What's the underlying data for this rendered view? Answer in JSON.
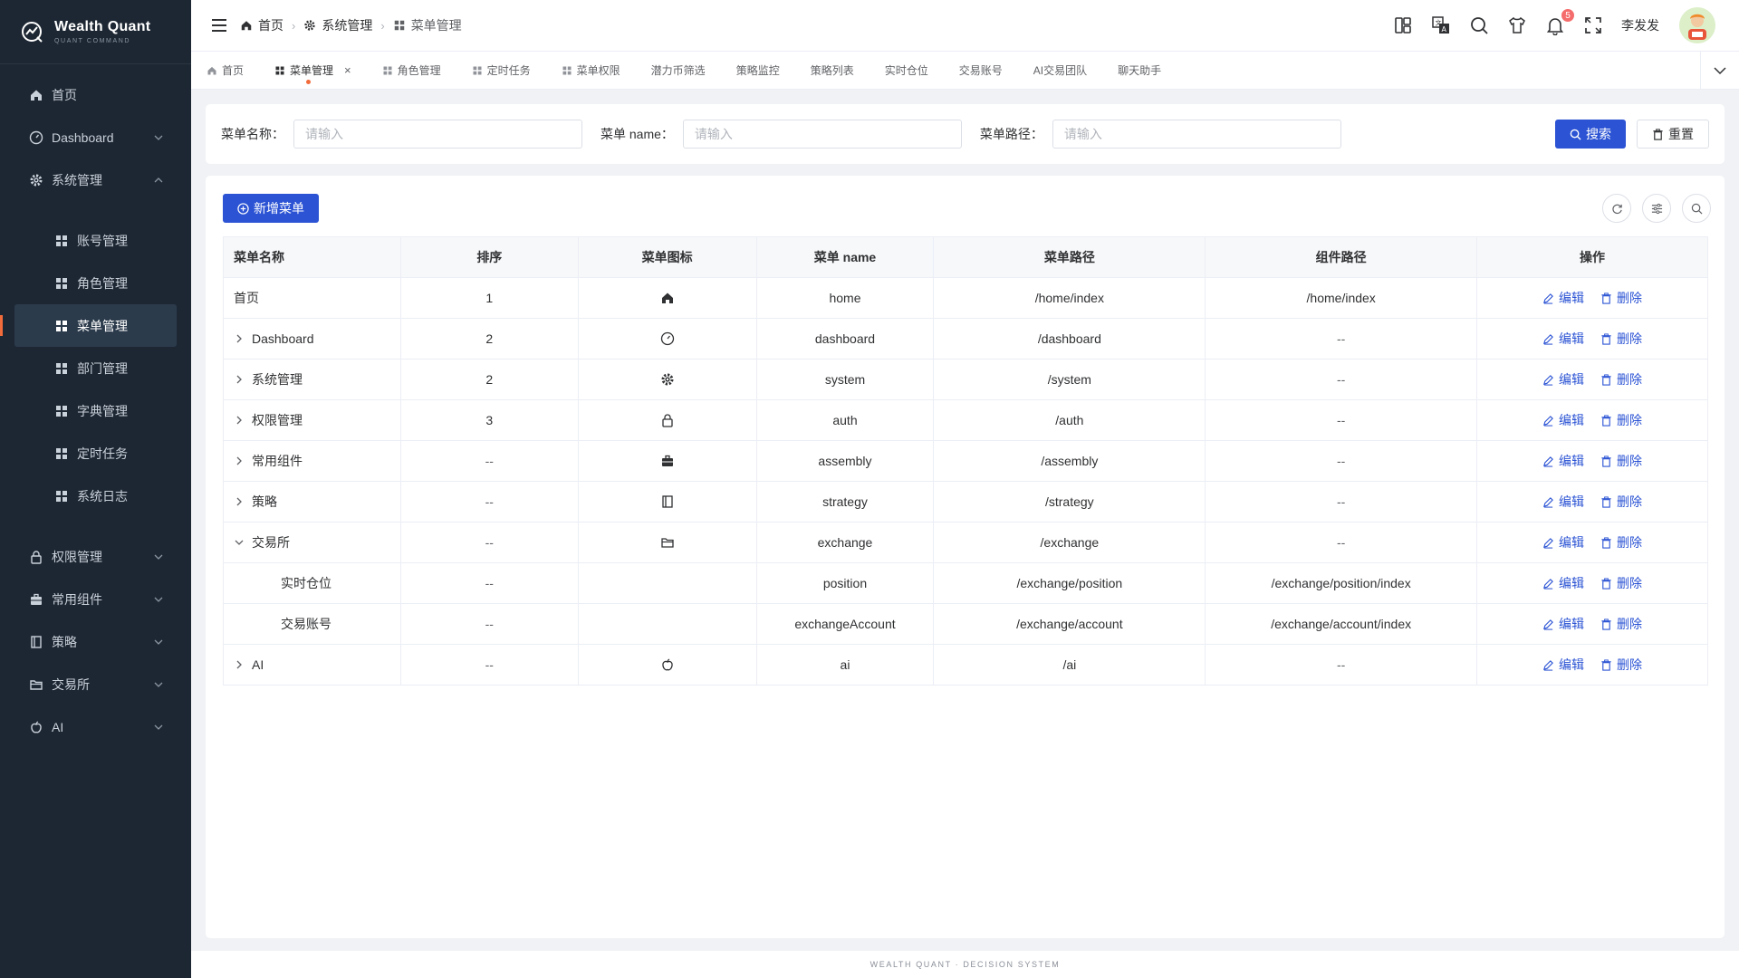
{
  "app": {
    "name": "Wealth Quant",
    "subtitle": "QUANT COMMAND",
    "footer": "WEALTH QUANT · DECISION SYSTEM"
  },
  "sidebar": {
    "items": [
      {
        "label": "首页",
        "icon": "home-icon"
      },
      {
        "label": "Dashboard",
        "icon": "dashboard-icon"
      },
      {
        "label": "系统管理",
        "icon": "gear-icon"
      }
    ],
    "system_children": [
      {
        "label": "账号管理"
      },
      {
        "label": "角色管理"
      },
      {
        "label": "菜单管理"
      },
      {
        "label": "部门管理"
      },
      {
        "label": "字典管理"
      },
      {
        "label": "定时任务"
      },
      {
        "label": "系统日志"
      }
    ],
    "bottom_items": [
      {
        "label": "权限管理",
        "icon": "lock-icon"
      },
      {
        "label": "常用组件",
        "icon": "briefcase-icon"
      },
      {
        "label": "策略",
        "icon": "notebook-icon"
      },
      {
        "label": "交易所",
        "icon": "folder-icon"
      },
      {
        "label": "AI",
        "icon": "apple-icon"
      }
    ]
  },
  "header": {
    "breadcrumb": [
      "首页",
      "系统管理",
      "菜单管理"
    ],
    "notification_count": "5",
    "username": "李发发"
  },
  "tabs": [
    "首页",
    "菜单管理",
    "角色管理",
    "定时任务",
    "菜单权限",
    "潜力币筛选",
    "策略监控",
    "策略列表",
    "实时仓位",
    "交易账号",
    "AI交易团队",
    "聊天助手"
  ],
  "search": {
    "name_label": "菜单名称：",
    "name_placeholder": "请输入",
    "en_label": "菜单 name：",
    "en_placeholder": "请输入",
    "path_label": "菜单路径：",
    "path_placeholder": "请输入",
    "search_btn": "搜索",
    "reset_btn": "重置"
  },
  "table": {
    "add_btn": "新增菜单",
    "columns": [
      "菜单名称",
      "排序",
      "菜单图标",
      "菜单 name",
      "菜单路径",
      "组件路径",
      "操作"
    ],
    "edit": "编辑",
    "delete": "删除",
    "rows": [
      {
        "name": "首页",
        "sort": "1",
        "icon": "home-icon",
        "en": "home",
        "path": "/home/index",
        "component": "/home/index"
      },
      {
        "name": "Dashboard",
        "sort": "2",
        "icon": "dashboard-icon",
        "en": "dashboard",
        "path": "/dashboard",
        "component": "--"
      },
      {
        "name": "系统管理",
        "sort": "2",
        "icon": "gear-icon",
        "en": "system",
        "path": "/system",
        "component": "--"
      },
      {
        "name": "权限管理",
        "sort": "3",
        "icon": "lock-icon",
        "en": "auth",
        "path": "/auth",
        "component": "--"
      },
      {
        "name": "常用组件",
        "sort": "--",
        "icon": "briefcase-icon",
        "en": "assembly",
        "path": "/assembly",
        "component": "--"
      },
      {
        "name": "策略",
        "sort": "--",
        "icon": "notebook-icon",
        "en": "strategy",
        "path": "/strategy",
        "component": "--"
      },
      {
        "name": "交易所",
        "sort": "--",
        "icon": "folder-icon",
        "en": "exchange",
        "path": "/exchange",
        "component": "--"
      },
      {
        "name": "实时仓位",
        "sort": "--",
        "icon": "",
        "en": "position",
        "path": "/exchange/position",
        "component": "/exchange/position/index"
      },
      {
        "name": "交易账号",
        "sort": "--",
        "icon": "",
        "en": "exchangeAccount",
        "path": "/exchange/account",
        "component": "/exchange/account/index"
      },
      {
        "name": "AI",
        "sort": "--",
        "icon": "apple-icon",
        "en": "ai",
        "path": "/ai",
        "component": "--"
      }
    ]
  },
  "colors": {
    "primary": "#2b53d4",
    "sidebar_bg": "#1d2733",
    "accent": "#f26b3a",
    "badge": "#f56c6c"
  }
}
